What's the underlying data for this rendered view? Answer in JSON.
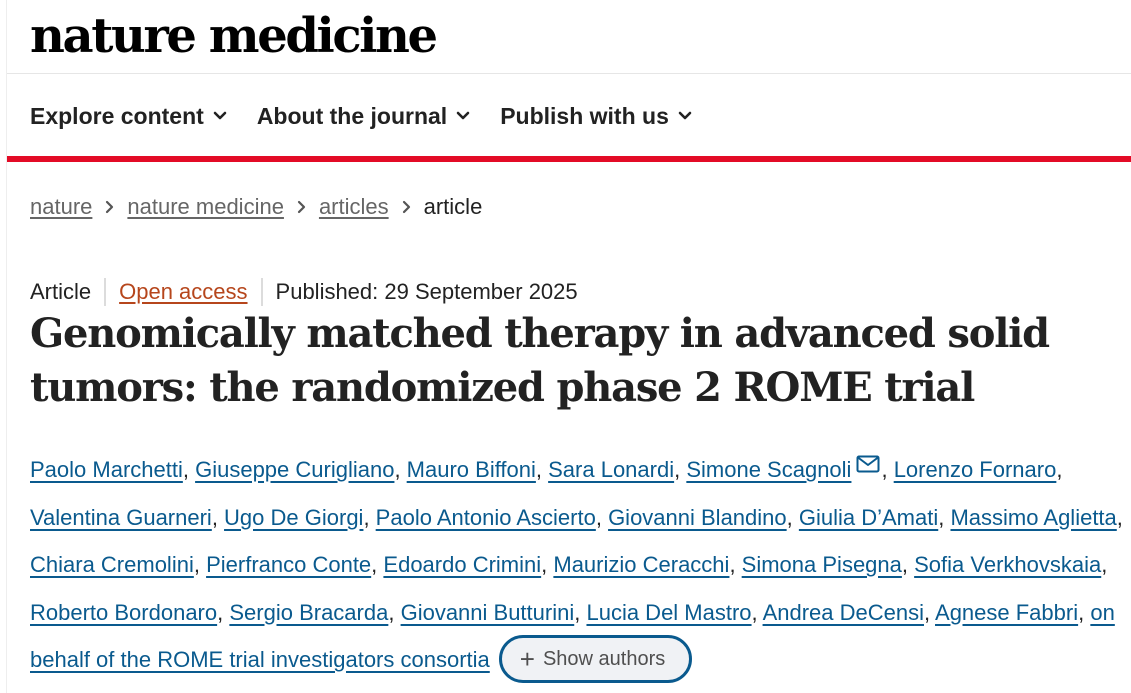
{
  "masthead": {
    "logo_text": "nature medicine"
  },
  "nav": {
    "items": [
      {
        "label": "Explore content"
      },
      {
        "label": "About the journal"
      },
      {
        "label": "Publish with us"
      }
    ]
  },
  "breadcrumb": {
    "items": [
      {
        "label": "nature"
      },
      {
        "label": "nature medicine"
      },
      {
        "label": "articles"
      }
    ],
    "current": "article"
  },
  "article": {
    "type": "Article",
    "access": "Open access",
    "published": "Published: 29 September 2025",
    "title": "Genomically matched therapy in advanced solid tumors: the randomized phase 2 ROME trial"
  },
  "authors": {
    "list": [
      "Paolo Marchetti",
      "Giuseppe Curigliano",
      "Mauro Biffoni",
      "Sara Lonardi",
      "Simone Scagnoli",
      "Lorenzo Fornaro",
      "Valentina Guarneri",
      "Ugo De Giorgi",
      "Paolo Antonio Ascierto",
      "Giovanni Blandino",
      "Giulia D’Amati",
      "Massimo Aglietta",
      "Chiara Cremolini",
      "Pierfranco Conte",
      "Edoardo Crimini",
      "Maurizio Ceracchi",
      "Simona Pisegna",
      "Sofia Verkhovskaia",
      "Roberto Bordonaro",
      "Sergio Bracarda",
      "Giovanni Butturini",
      "Lucia Del Mastro",
      "Andrea DeCensi",
      "Agnese Fabbri",
      "on behalf of the ROME trial investigators consortia"
    ],
    "corresponding_index": 4,
    "show_authors_label": "Show authors"
  },
  "colors": {
    "brand_red": "#e30b26",
    "link_blue": "#0a5a8e",
    "open_access_orange": "#b6461c",
    "text": "#222222"
  },
  "icons": {
    "nav_chevron": "chevron-down-icon",
    "breadcrumb_separator": "chevron-right-icon",
    "corresponding": "mail-icon",
    "expand": "plus-icon"
  }
}
